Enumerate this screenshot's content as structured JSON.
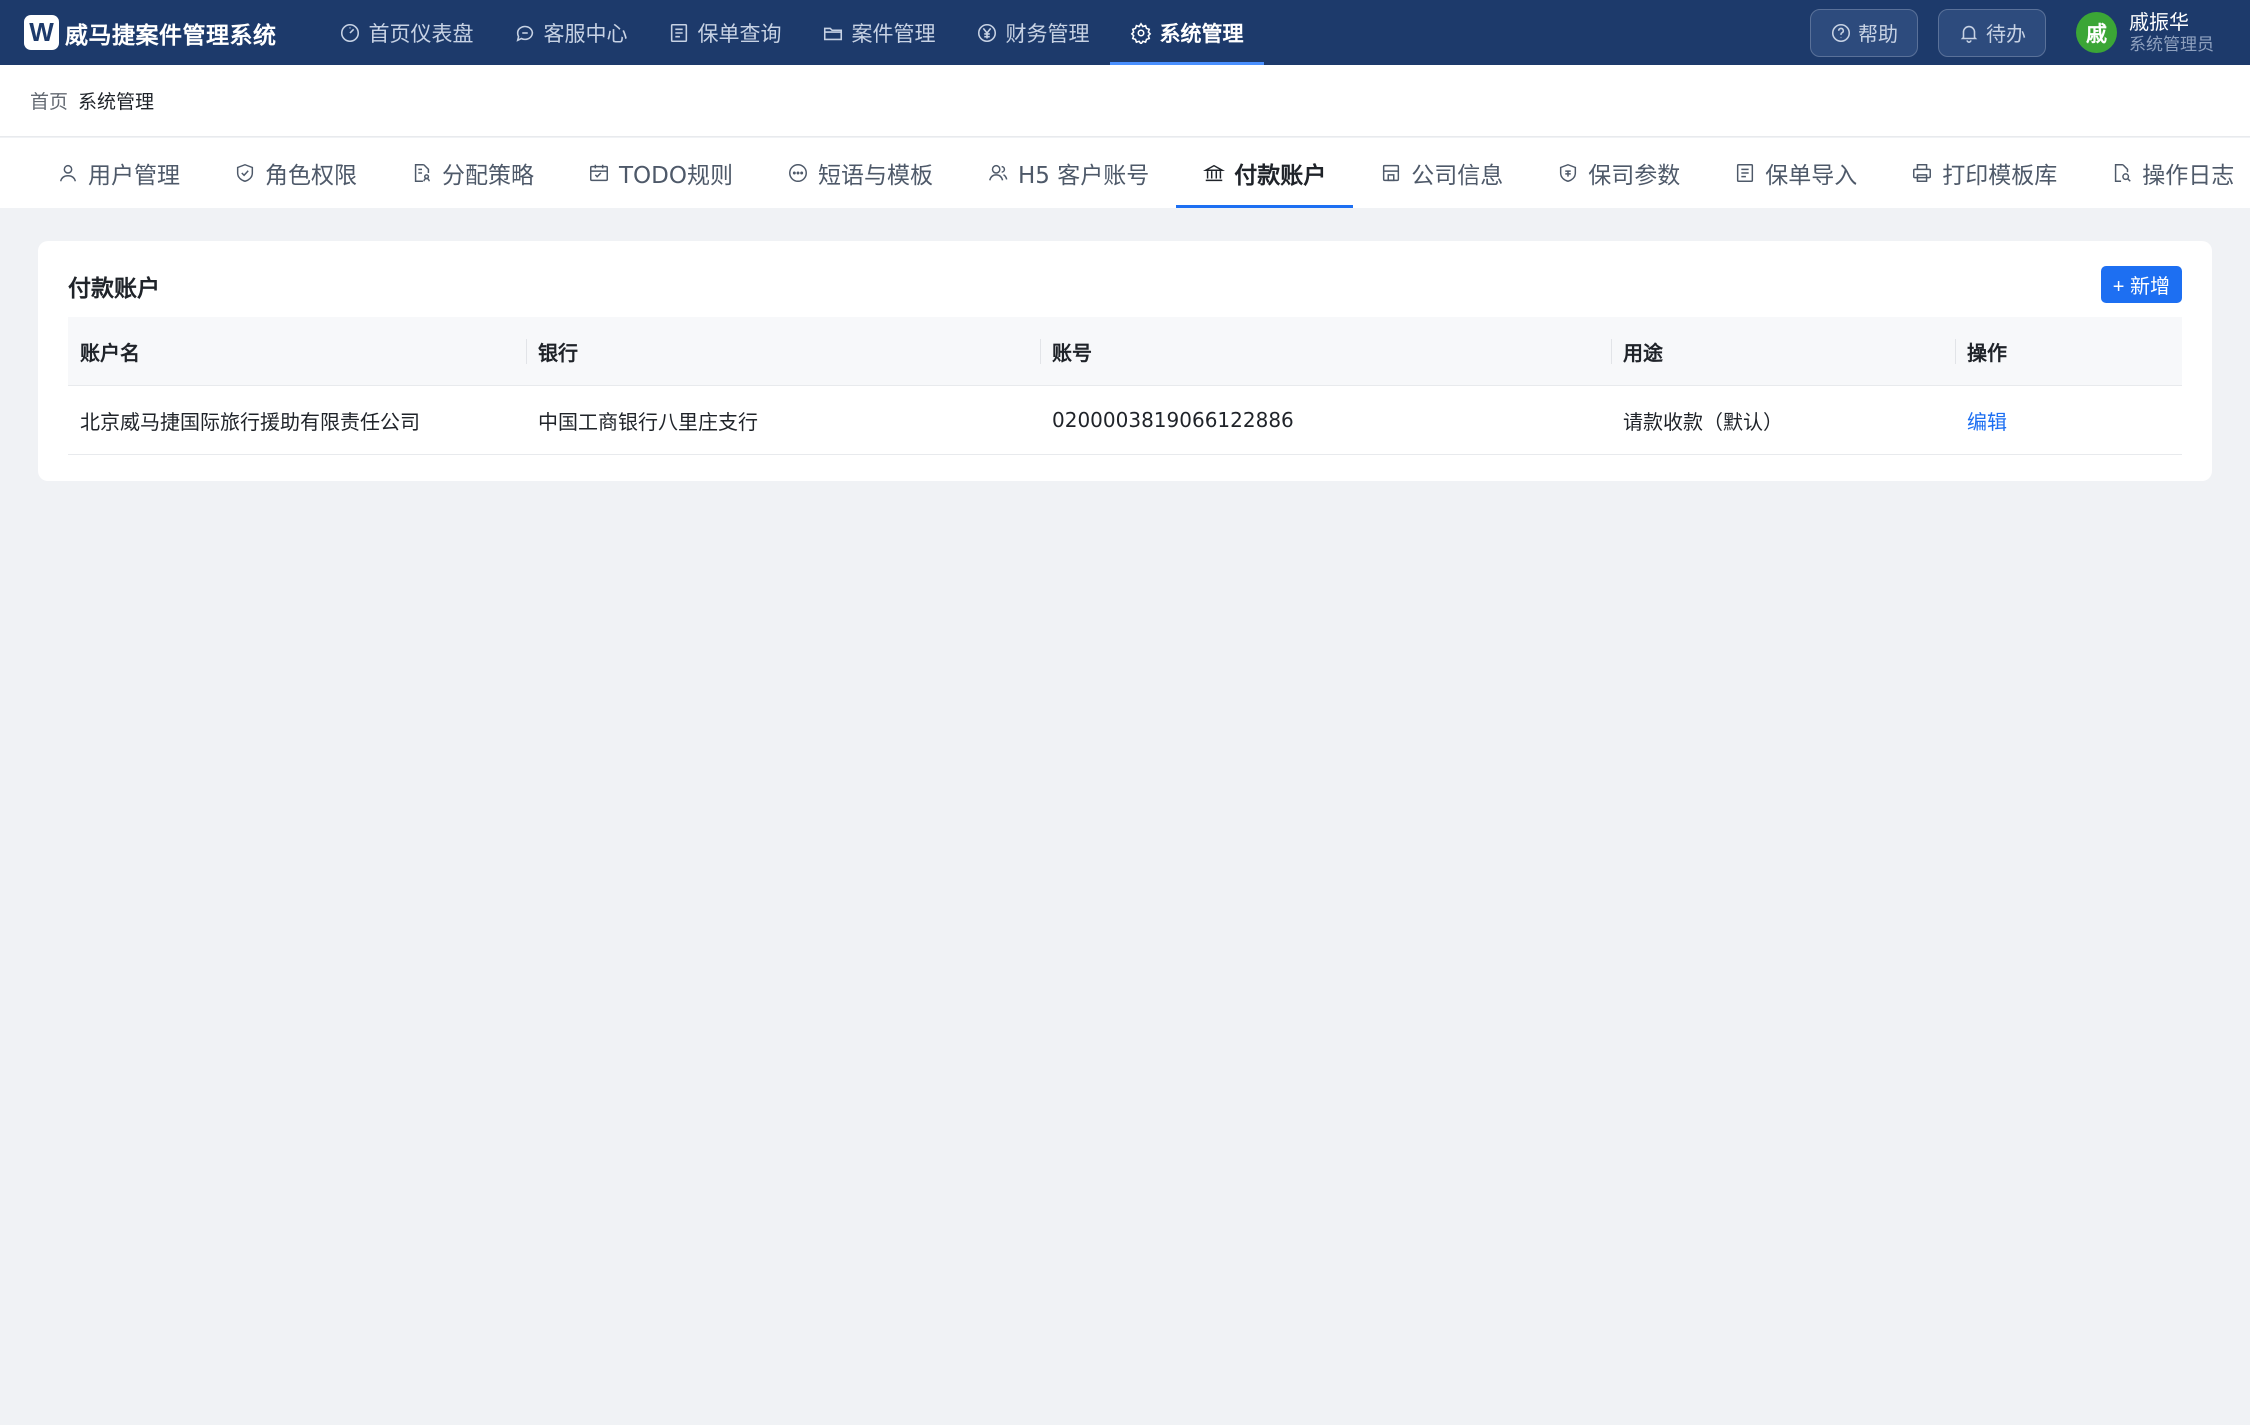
{
  "app": {
    "logo_letter": "W",
    "title": "威马捷案件管理系统"
  },
  "topnav": [
    {
      "label": "首页仪表盘",
      "icon": "dashboard-icon"
    },
    {
      "label": "客服中心",
      "icon": "chat-icon"
    },
    {
      "label": "保单查询",
      "icon": "list-icon"
    },
    {
      "label": "案件管理",
      "icon": "folder-icon"
    },
    {
      "label": "财务管理",
      "icon": "yen-icon"
    },
    {
      "label": "系统管理",
      "icon": "gear-icon",
      "active": true
    }
  ],
  "topbar": {
    "help_label": "帮助",
    "todo_label": "待办"
  },
  "user": {
    "avatar_letter": "戚",
    "name": "戚振华",
    "role": "系统管理员"
  },
  "breadcrumb": {
    "home": "首页",
    "current": "系统管理"
  },
  "subtabs": [
    {
      "label": "用户管理",
      "icon": "user-icon"
    },
    {
      "label": "角色权限",
      "icon": "shield-check-icon"
    },
    {
      "label": "分配策略",
      "icon": "doc-person-icon"
    },
    {
      "label": "TODO规则",
      "icon": "calendar-icon"
    },
    {
      "label": "短语与模板",
      "icon": "message-icon"
    },
    {
      "label": "H5 客户账号",
      "icon": "users-icon"
    },
    {
      "label": "付款账户",
      "icon": "bank-icon",
      "active": true
    },
    {
      "label": "公司信息",
      "icon": "building-icon"
    },
    {
      "label": "保司参数",
      "icon": "shield-badge-icon"
    },
    {
      "label": "保单导入",
      "icon": "list-icon"
    },
    {
      "label": "打印模板库",
      "icon": "printer-icon"
    },
    {
      "label": "操作日志",
      "icon": "doc-search-icon"
    }
  ],
  "card": {
    "title": "付款账户",
    "add_label": "+ 新增",
    "columns": [
      "账户名",
      "银行",
      "账号",
      "用途",
      "操作"
    ],
    "rows": [
      {
        "name": "北京威马捷国际旅行援助有限责任公司",
        "bank": "中国工商银行八里庄支行",
        "account": "0200003819066122886",
        "purpose": "请款收款（默认）",
        "action": "编辑"
      }
    ]
  },
  "colors": {
    "topbar": "#1d3a6b",
    "accent": "#1d6ff2",
    "avatar": "#3ba636",
    "background": "#f0f2f5"
  }
}
